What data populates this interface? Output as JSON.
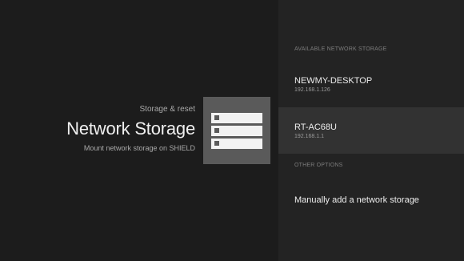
{
  "header": {
    "breadcrumb": "Storage & reset",
    "title": "Network Storage",
    "subtitle": "Mount network storage on SHIELD",
    "icon": "network-storage-icon"
  },
  "available": {
    "section_label": "AVAILABLE NETWORK STORAGE",
    "items": [
      {
        "name": "NEWMY-DESKTOP",
        "address": "192.168.1.126"
      },
      {
        "name": "RT-AC68U",
        "address": "192.168.1.1"
      }
    ]
  },
  "other": {
    "section_label": "OTHER OPTIONS",
    "items": [
      {
        "name": "Manually add a network storage"
      }
    ]
  },
  "colors": {
    "left_background": "#1c1c1c",
    "right_background": "#232323",
    "selected_background": "#323232",
    "icon_tile": "#5a5a5a"
  }
}
